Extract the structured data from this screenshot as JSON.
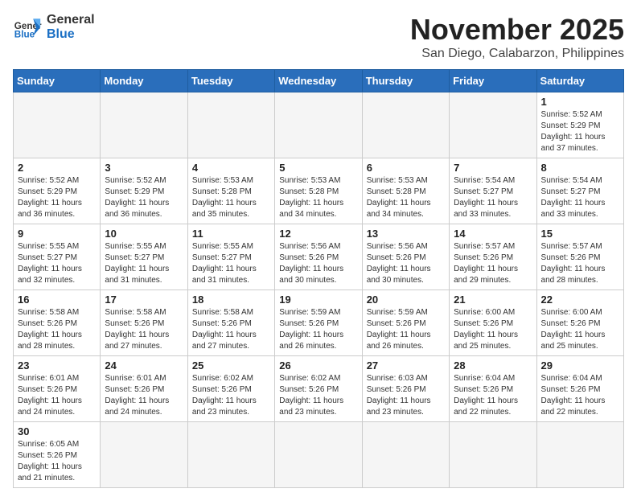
{
  "header": {
    "logo_general": "General",
    "logo_blue": "Blue",
    "title": "November 2025",
    "subtitle": "San Diego, Calabarzon, Philippines"
  },
  "days_of_week": [
    "Sunday",
    "Monday",
    "Tuesday",
    "Wednesday",
    "Thursday",
    "Friday",
    "Saturday"
  ],
  "weeks": [
    [
      {
        "day": "",
        "info": "",
        "empty": true
      },
      {
        "day": "",
        "info": "",
        "empty": true
      },
      {
        "day": "",
        "info": "",
        "empty": true
      },
      {
        "day": "",
        "info": "",
        "empty": true
      },
      {
        "day": "",
        "info": "",
        "empty": true
      },
      {
        "day": "",
        "info": "",
        "empty": true
      },
      {
        "day": "1",
        "info": "Sunrise: 5:52 AM\nSunset: 5:29 PM\nDaylight: 11 hours and 37 minutes.",
        "empty": false
      }
    ],
    [
      {
        "day": "2",
        "info": "Sunrise: 5:52 AM\nSunset: 5:29 PM\nDaylight: 11 hours and 36 minutes.",
        "empty": false
      },
      {
        "day": "3",
        "info": "Sunrise: 5:52 AM\nSunset: 5:29 PM\nDaylight: 11 hours and 36 minutes.",
        "empty": false
      },
      {
        "day": "4",
        "info": "Sunrise: 5:53 AM\nSunset: 5:28 PM\nDaylight: 11 hours and 35 minutes.",
        "empty": false
      },
      {
        "day": "5",
        "info": "Sunrise: 5:53 AM\nSunset: 5:28 PM\nDaylight: 11 hours and 34 minutes.",
        "empty": false
      },
      {
        "day": "6",
        "info": "Sunrise: 5:53 AM\nSunset: 5:28 PM\nDaylight: 11 hours and 34 minutes.",
        "empty": false
      },
      {
        "day": "7",
        "info": "Sunrise: 5:54 AM\nSunset: 5:27 PM\nDaylight: 11 hours and 33 minutes.",
        "empty": false
      },
      {
        "day": "8",
        "info": "Sunrise: 5:54 AM\nSunset: 5:27 PM\nDaylight: 11 hours and 33 minutes.",
        "empty": false
      }
    ],
    [
      {
        "day": "9",
        "info": "Sunrise: 5:55 AM\nSunset: 5:27 PM\nDaylight: 11 hours and 32 minutes.",
        "empty": false
      },
      {
        "day": "10",
        "info": "Sunrise: 5:55 AM\nSunset: 5:27 PM\nDaylight: 11 hours and 31 minutes.",
        "empty": false
      },
      {
        "day": "11",
        "info": "Sunrise: 5:55 AM\nSunset: 5:27 PM\nDaylight: 11 hours and 31 minutes.",
        "empty": false
      },
      {
        "day": "12",
        "info": "Sunrise: 5:56 AM\nSunset: 5:26 PM\nDaylight: 11 hours and 30 minutes.",
        "empty": false
      },
      {
        "day": "13",
        "info": "Sunrise: 5:56 AM\nSunset: 5:26 PM\nDaylight: 11 hours and 30 minutes.",
        "empty": false
      },
      {
        "day": "14",
        "info": "Sunrise: 5:57 AM\nSunset: 5:26 PM\nDaylight: 11 hours and 29 minutes.",
        "empty": false
      },
      {
        "day": "15",
        "info": "Sunrise: 5:57 AM\nSunset: 5:26 PM\nDaylight: 11 hours and 28 minutes.",
        "empty": false
      }
    ],
    [
      {
        "day": "16",
        "info": "Sunrise: 5:58 AM\nSunset: 5:26 PM\nDaylight: 11 hours and 28 minutes.",
        "empty": false
      },
      {
        "day": "17",
        "info": "Sunrise: 5:58 AM\nSunset: 5:26 PM\nDaylight: 11 hours and 27 minutes.",
        "empty": false
      },
      {
        "day": "18",
        "info": "Sunrise: 5:58 AM\nSunset: 5:26 PM\nDaylight: 11 hours and 27 minutes.",
        "empty": false
      },
      {
        "day": "19",
        "info": "Sunrise: 5:59 AM\nSunset: 5:26 PM\nDaylight: 11 hours and 26 minutes.",
        "empty": false
      },
      {
        "day": "20",
        "info": "Sunrise: 5:59 AM\nSunset: 5:26 PM\nDaylight: 11 hours and 26 minutes.",
        "empty": false
      },
      {
        "day": "21",
        "info": "Sunrise: 6:00 AM\nSunset: 5:26 PM\nDaylight: 11 hours and 25 minutes.",
        "empty": false
      },
      {
        "day": "22",
        "info": "Sunrise: 6:00 AM\nSunset: 5:26 PM\nDaylight: 11 hours and 25 minutes.",
        "empty": false
      }
    ],
    [
      {
        "day": "23",
        "info": "Sunrise: 6:01 AM\nSunset: 5:26 PM\nDaylight: 11 hours and 24 minutes.",
        "empty": false
      },
      {
        "day": "24",
        "info": "Sunrise: 6:01 AM\nSunset: 5:26 PM\nDaylight: 11 hours and 24 minutes.",
        "empty": false
      },
      {
        "day": "25",
        "info": "Sunrise: 6:02 AM\nSunset: 5:26 PM\nDaylight: 11 hours and 23 minutes.",
        "empty": false
      },
      {
        "day": "26",
        "info": "Sunrise: 6:02 AM\nSunset: 5:26 PM\nDaylight: 11 hours and 23 minutes.",
        "empty": false
      },
      {
        "day": "27",
        "info": "Sunrise: 6:03 AM\nSunset: 5:26 PM\nDaylight: 11 hours and 23 minutes.",
        "empty": false
      },
      {
        "day": "28",
        "info": "Sunrise: 6:04 AM\nSunset: 5:26 PM\nDaylight: 11 hours and 22 minutes.",
        "empty": false
      },
      {
        "day": "29",
        "info": "Sunrise: 6:04 AM\nSunset: 5:26 PM\nDaylight: 11 hours and 22 minutes.",
        "empty": false
      }
    ],
    [
      {
        "day": "30",
        "info": "Sunrise: 6:05 AM\nSunset: 5:26 PM\nDaylight: 11 hours and 21 minutes.",
        "empty": false
      },
      {
        "day": "",
        "info": "",
        "empty": true
      },
      {
        "day": "",
        "info": "",
        "empty": true
      },
      {
        "day": "",
        "info": "",
        "empty": true
      },
      {
        "day": "",
        "info": "",
        "empty": true
      },
      {
        "day": "",
        "info": "",
        "empty": true
      },
      {
        "day": "",
        "info": "",
        "empty": true
      }
    ]
  ]
}
